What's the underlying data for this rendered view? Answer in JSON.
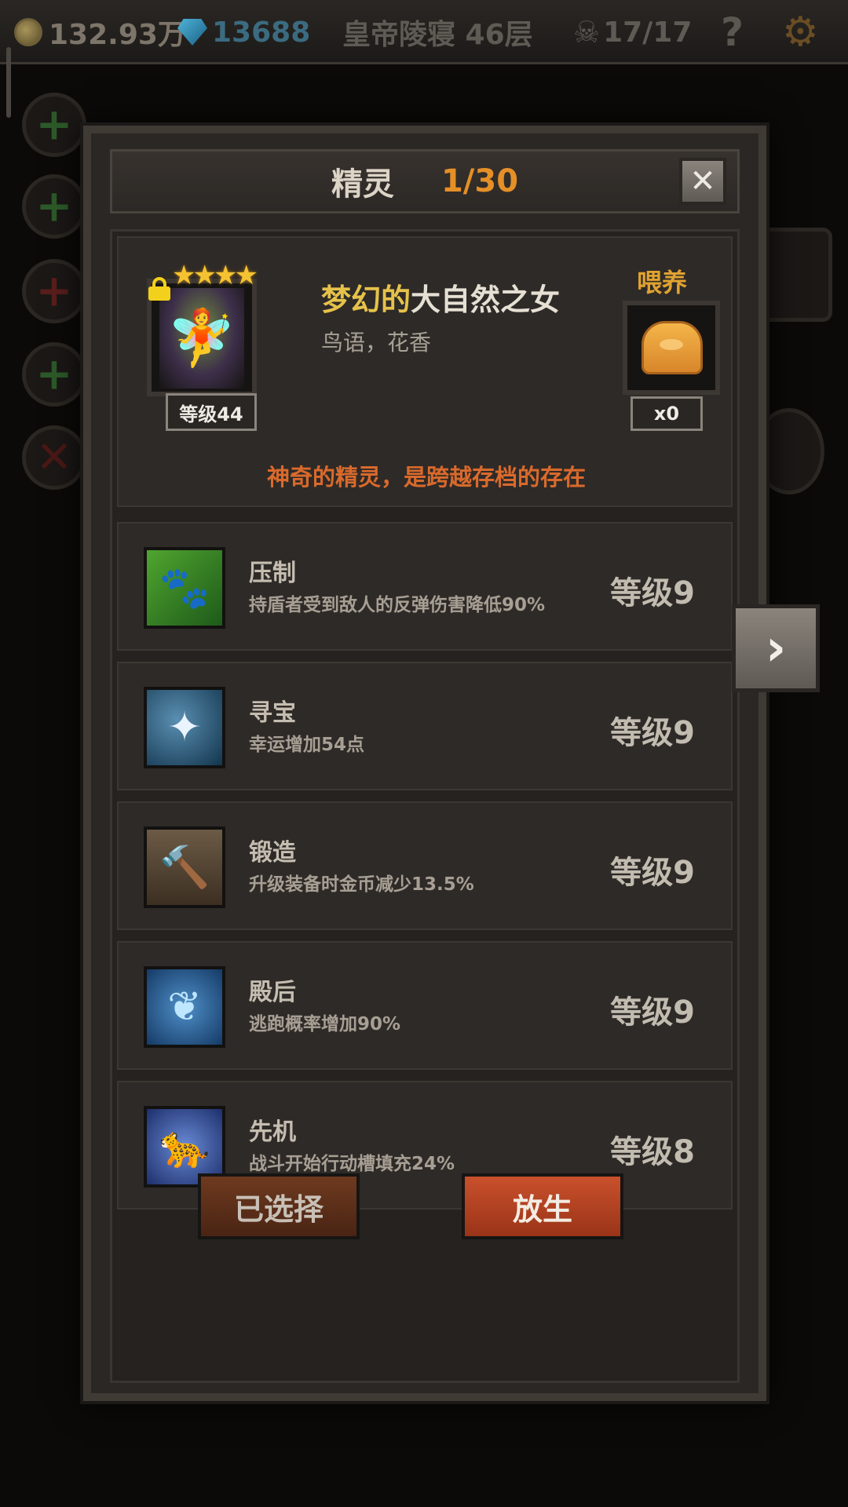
{
  "topbar": {
    "gold": "132.93万",
    "gems": "13688",
    "location": "皇帝陵寝 46层",
    "kills": "17/17",
    "help_glyph": "?",
    "settings_glyph": "⚙"
  },
  "modal": {
    "title": "精灵",
    "count": "1/30",
    "close_glyph": "✕"
  },
  "spirit": {
    "stars": 4,
    "level": "等级44",
    "name_prefix": "梦幻的",
    "name_main": "大自然之女",
    "subtitle": "鸟语，花香",
    "feed_label": "喂养",
    "feed_count": "x0",
    "description": "神奇的精灵，是跨越存档的存在"
  },
  "skills": [
    {
      "name": "压制",
      "desc": "持盾者受到敌人的反弹伤害降低90%",
      "level": "等级9",
      "icon": "claw-icon"
    },
    {
      "name": "寻宝",
      "desc": "幸运增加54点",
      "level": "等级9",
      "icon": "sparkle-silhouette-icon"
    },
    {
      "name": "锻造",
      "desc": "升级装备时金币减少13.5%",
      "level": "等级9",
      "icon": "hammer-icon"
    },
    {
      "name": "殿后",
      "desc": "逃跑概率增加90%",
      "level": "等级9",
      "icon": "wings-icon"
    },
    {
      "name": "先机",
      "desc": "战斗开始行动槽填充24%",
      "level": "等级8",
      "icon": "leopard-icon"
    }
  ],
  "buttons": {
    "selected": "已选择",
    "release": "放生"
  },
  "nav": {
    "next_glyph": "›"
  },
  "colors": {
    "accent_orange": "#e58f27",
    "name_gold": "#e6c24b",
    "desc_orange": "#d96a2c",
    "release_red": "#c9502c"
  }
}
